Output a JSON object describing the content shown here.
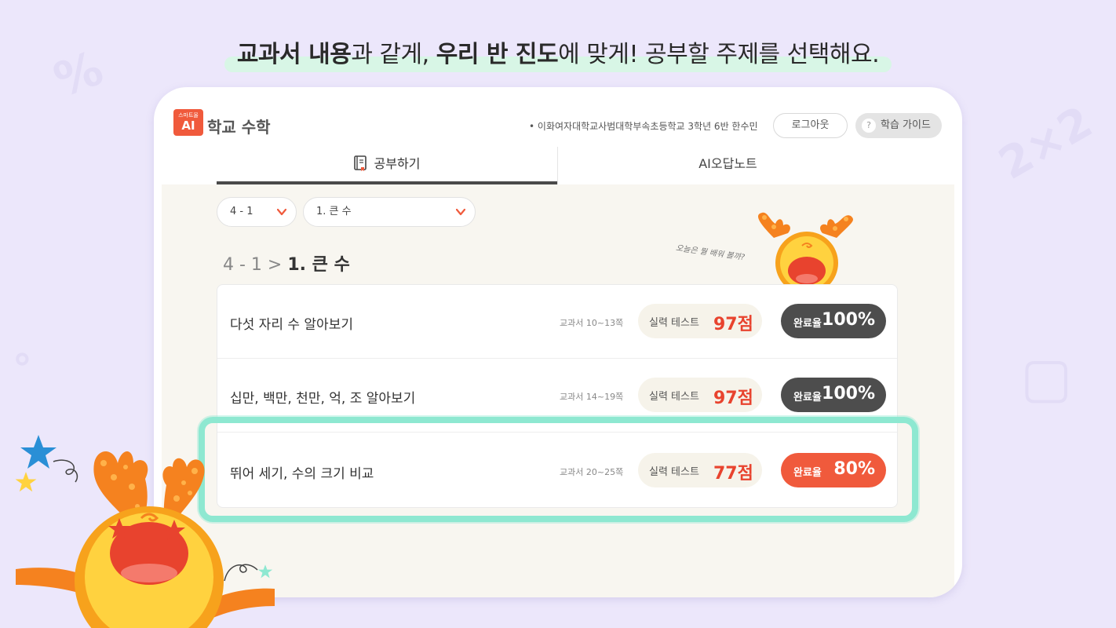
{
  "headline": {
    "part1_bold": "교과서 내용",
    "part2": "과 같게, ",
    "part3_bold": "우리 반 진도",
    "part4": "에 맞게! 공부할 주제를 선택해요."
  },
  "app": {
    "logo_small": "스마트올",
    "logo_ai": "AI",
    "title": "학교 수학",
    "user_info": "이화여자대학교사범대학부속초등학교 3학년 6반 한수민",
    "logout_label": "로그아웃",
    "guide_label": "학습 가이드",
    "guide_icon_char": "?"
  },
  "tabs": [
    {
      "label": "공부하기",
      "icon": "book-icon",
      "active": true
    },
    {
      "label": "AI오답노트",
      "active": false
    }
  ],
  "filters": {
    "grade_value": "4 - 1",
    "unit_value": "1. 큰 수"
  },
  "breadcrumb": {
    "grade": "4 - 1",
    "separator": ">",
    "unit": "1. 큰 수"
  },
  "mascot_bubble": "오늘은 뭘 배워 볼까?",
  "lessons": [
    {
      "title": "다섯 자리 수 알아보기",
      "pages": "교과서 10~13쪽",
      "test_label": "실력 테스트",
      "score": "97점",
      "rate_label": "완료율",
      "rate": "100%"
    },
    {
      "title": "십만, 백만, 천만, 억, 조 알아보기",
      "pages": "교과서 14~19쪽",
      "test_label": "실력 테스트",
      "score": "97점",
      "rate_label": "완료율",
      "rate": "100%"
    },
    {
      "title": "뛰어 세기, 수의 크기 비교",
      "pages": "교과서 20~25쪽",
      "test_label": "실력 테스트",
      "score": "77점",
      "rate_label": "완료율",
      "rate": "80%"
    }
  ],
  "colors": {
    "accent": "#f05a3c",
    "highlight": "#8ee8d1",
    "background": "#ece7fb",
    "dark_pill": "#4d4d4d"
  }
}
